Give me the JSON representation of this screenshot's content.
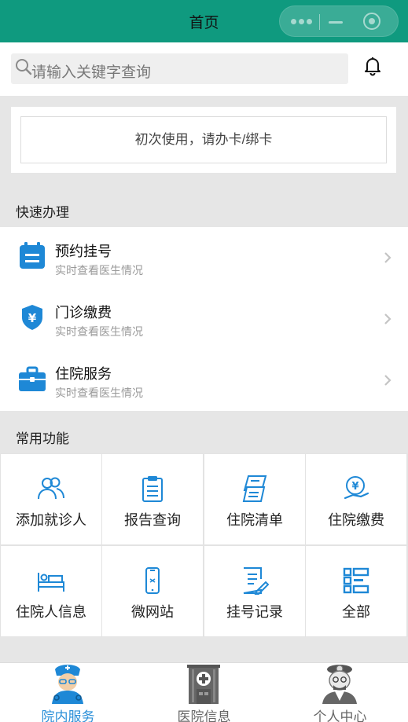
{
  "nav": {
    "title": "首页"
  },
  "search": {
    "placeholder": "请输入关键字查询"
  },
  "card": {
    "label": "初次使用，请办卡/绑卡"
  },
  "quick": {
    "title": "快速办理",
    "items": [
      {
        "title": "预约挂号",
        "subtitle": "实时查看医生情况",
        "icon": "calendar-icon"
      },
      {
        "title": "门诊缴费",
        "subtitle": "实时查看医生情况",
        "icon": "yuan-shield-icon"
      },
      {
        "title": "住院服务",
        "subtitle": "实时查看医生情况",
        "icon": "briefcase-icon"
      }
    ]
  },
  "common": {
    "title": "常用功能",
    "items": [
      {
        "label": "添加就诊人",
        "icon": "add-patient-icon"
      },
      {
        "label": "报告查询",
        "icon": "clipboard-report-icon"
      },
      {
        "label": "住院清单",
        "icon": "inpatient-list-icon"
      },
      {
        "label": "住院缴费",
        "icon": "inpatient-payment-icon"
      },
      {
        "label": "住院人信息",
        "icon": "hospital-bed-icon"
      },
      {
        "label": "微网站",
        "icon": "mobile-site-icon"
      },
      {
        "label": "挂号记录",
        "icon": "registration-record-icon"
      },
      {
        "label": "全部",
        "icon": "all-grid-icon"
      }
    ]
  },
  "tabbar": {
    "items": [
      {
        "label": "院内服务",
        "icon": "nurse-icon",
        "active": true
      },
      {
        "label": "医院信息",
        "icon": "hospital-building-icon",
        "active": false
      },
      {
        "label": "个人中心",
        "icon": "doctor-icon",
        "active": false
      }
    ]
  },
  "colors": {
    "nav": "#0f9a7f",
    "accent": "#2a8fd8",
    "icon_blue": "#1e88d6"
  }
}
